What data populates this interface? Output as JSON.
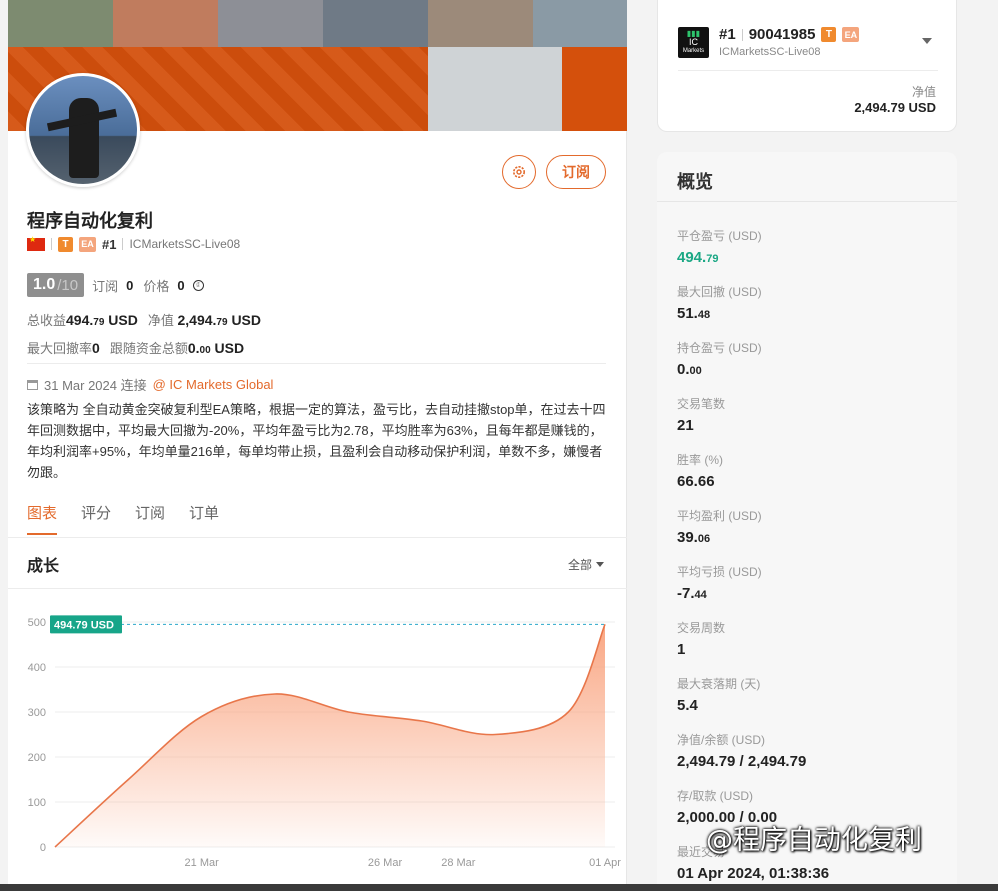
{
  "profile": {
    "name": "程序自动化复利",
    "badge_t": "T",
    "badge_ea": "EA",
    "rank": "#1",
    "server": "ICMarketsSC-Live08",
    "score": "1.0",
    "score_den": "/10",
    "subs_label": "订阅",
    "subs_value": "0",
    "price_label": "价格",
    "price_value": "0",
    "total_profit_label": "总收益",
    "total_profit_value": "494.",
    "total_profit_dec": "79",
    "total_profit_unit": "USD",
    "equity_label": "净值",
    "equity_value": "2,494.",
    "equity_dec": "79",
    "equity_unit": "USD",
    "max_dd_label": "最大回撤率",
    "max_dd_value": "0",
    "follow_label": "跟随资金总额",
    "follow_value": "0.",
    "follow_dec": "00",
    "follow_unit": "USD",
    "connected_date": "31 Mar 2024 连接",
    "broker_link": "@ IC Markets Global",
    "description": "该策略为 全自动黄金突破复利型EA策略，根据一定的算法，盈亏比，去自动挂撤stop单，在过去十四年回测数据中，平均最大回撤为-20%，平均年盈亏比为2.78，平均胜率为63%，且每年都是赚钱的，年均利润率+95%，年均单量216单，每单均带止损，且盈利会自动移动保护利润，单数不多，嫌慢者勿跟。",
    "subscribe_label": "订阅"
  },
  "tabs": [
    "图表",
    "评分",
    "订阅",
    "订单"
  ],
  "chart_section": {
    "title": "成长",
    "range_label": "全部"
  },
  "chart_data": {
    "type": "area",
    "x": [
      "2024-03-17",
      "2024-03-19",
      "2024-03-21",
      "2024-03-23",
      "2024-03-25",
      "2024-03-27",
      "2024-03-29",
      "2024-03-31",
      "2024-04-01"
    ],
    "x_tick_labels": [
      "21 Mar",
      "26 Mar",
      "28 Mar",
      "01 Apr"
    ],
    "y_ticks": [
      "0",
      "100",
      "200",
      "300",
      "400",
      "500"
    ],
    "ylim": [
      0,
      500
    ],
    "series": [
      {
        "values": [
          0,
          150,
          290,
          340,
          300,
          280,
          250,
          300,
          494.79
        ]
      }
    ],
    "current_label": "494.79 USD",
    "colors": {
      "line": "#e8764a",
      "fill": "#f9a27d",
      "marker": "#17a589"
    }
  },
  "account": {
    "logo_text": "IC",
    "logo_sub": "Markets",
    "rank": "#1",
    "number": "90041985",
    "badge_t": "T",
    "badge_ea": "EA",
    "server": "ICMarketsSC-Live08",
    "equity_label": "净值",
    "equity_value": "2,494.79 USD"
  },
  "overview": {
    "title": "概览",
    "items": [
      {
        "label": "平仓盈亏 (USD)",
        "value": "494.",
        "dec": "79",
        "green": true
      },
      {
        "label": "最大回撤 (USD)",
        "value": "51.",
        "dec": "48"
      },
      {
        "label": "持仓盈亏 (USD)",
        "value": "0.",
        "dec": "00"
      },
      {
        "label": "交易笔数",
        "value": "21",
        "dec": ""
      },
      {
        "label": "胜率 (%)",
        "value": "66.66",
        "dec": ""
      },
      {
        "label": "平均盈利 (USD)",
        "value": "39.",
        "dec": "06"
      },
      {
        "label": "平均亏损 (USD)",
        "value": "-7.",
        "dec": "44"
      },
      {
        "label": "交易周数",
        "value": "1",
        "dec": ""
      },
      {
        "label": "最大衰落期 (天)",
        "value": "5.4",
        "dec": ""
      },
      {
        "label": "净值/余额 (USD)",
        "value": "2,494.79 / 2,494.79",
        "dec": ""
      },
      {
        "label": "存/取款 (USD)",
        "value": "2,000.00 / 0.00",
        "dec": ""
      },
      {
        "label": "最近交易",
        "value": "01 Apr 2024, 01:38:36",
        "dec": ""
      }
    ]
  },
  "watermark": "@程序自动化复利",
  "colors": {
    "accent": "#e36a2c",
    "banner": "#d4500c",
    "green": "#1aa784"
  }
}
